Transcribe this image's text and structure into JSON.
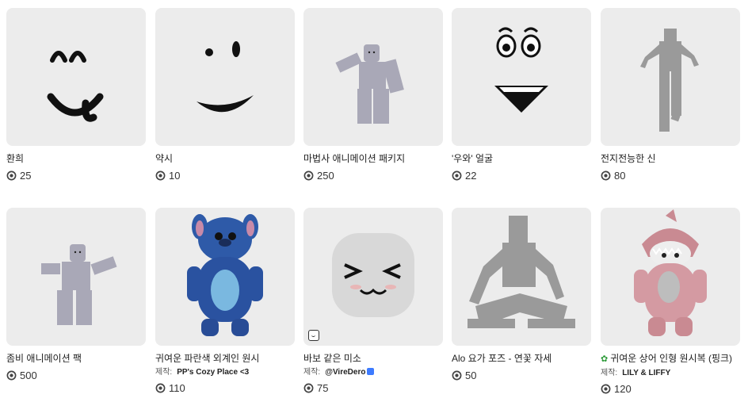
{
  "items": [
    {
      "name": "환희",
      "price": "25",
      "icon": "face-joy"
    },
    {
      "name": "약시",
      "price": "10",
      "icon": "face-wink"
    },
    {
      "name": "마법사 애니메이션 패키지",
      "price": "250",
      "icon": "mage-animation"
    },
    {
      "name": "'우와' 얼굴",
      "price": "22",
      "icon": "face-wow"
    },
    {
      "name": "전지전능한 신",
      "price": "80",
      "icon": "god-pose"
    },
    {
      "name": "좀비 애니메이션 팩",
      "price": "500",
      "icon": "zombie-animation"
    },
    {
      "name": "귀여운 파란색 외계인 원시",
      "creator_label": "제작:",
      "creator": "PP's Cozy Place <3",
      "price": "110",
      "icon": "blue-alien-suit"
    },
    {
      "name": "바보 같은 미소",
      "creator_label": "제작:",
      "creator": "@VireDero",
      "price": "75",
      "icon": "silly-smile-head"
    },
    {
      "name": "Alo 요가 포즈 - 연꽃 자세",
      "price": "50",
      "icon": "lotus-pose"
    },
    {
      "name": "귀여운 상어 인형 원시복 (핑크)",
      "creator_label": "제작:",
      "creator": "LILY & LIFFY",
      "price": "120",
      "icon": "pink-shark-suit"
    }
  ]
}
